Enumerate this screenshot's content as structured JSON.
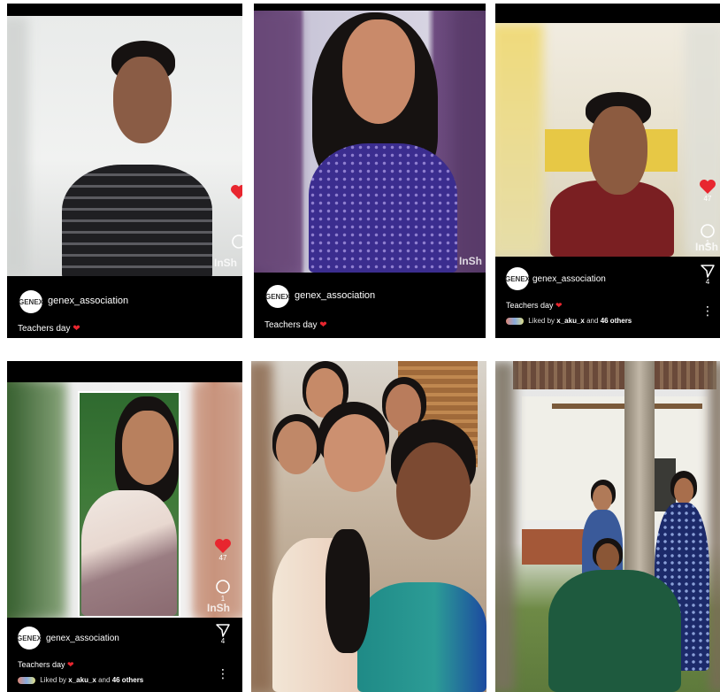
{
  "header_fragment": "",
  "reels": [
    {
      "username": "genex_association",
      "caption": "Teachers day",
      "watermark": "InSh",
      "likes": "",
      "comments": "",
      "liked_by": ""
    },
    {
      "username": "genex_association",
      "caption": "Teachers day",
      "watermark": "InSh",
      "likes": "",
      "comments": "",
      "liked_by": ""
    },
    {
      "username": "genex_association",
      "caption": "Teachers day",
      "watermark": "InSh",
      "likes": "47",
      "comments": "1",
      "shares": "4",
      "liked_by_prefix": "Liked by",
      "liked_by_user": "x_aku_x",
      "liked_by_and": "and",
      "liked_by_others": "46 others"
    },
    {
      "username": "genex_association",
      "caption": "Teachers day",
      "watermark": "InSh",
      "likes": "47",
      "comments": "1",
      "shares": "4",
      "liked_by_prefix": "Liked by",
      "liked_by_user": "x_aku_x",
      "liked_by_and": "and",
      "liked_by_others": "46 others"
    }
  ],
  "avatar_text": "GENEX",
  "colors": {
    "like": "#e8262f",
    "panel": "#000000",
    "text": "#ffffff"
  },
  "icons": [
    "heart-icon",
    "comment-icon",
    "share-icon",
    "more-icon"
  ]
}
